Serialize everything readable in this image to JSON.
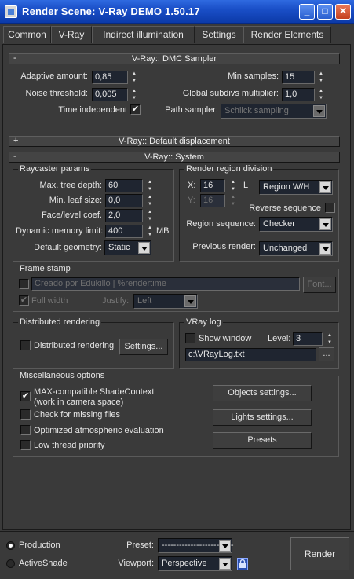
{
  "window": {
    "title": "Render Scene: V-Ray DEMO 1.50.17",
    "controls": [
      "_",
      "□",
      "✕"
    ]
  },
  "tabs": [
    "Common",
    "V-Ray",
    "Indirect illumination",
    "Settings",
    "Render Elements"
  ],
  "dmc": {
    "title": "V-Ray:: DMC Sampler",
    "sign": "-",
    "adaptive_amount_label": "Adaptive amount:",
    "adaptive_amount": "0,85",
    "noise_threshold_label": "Noise threshold:",
    "noise_threshold": "0,005",
    "time_independent_label": "Time independent",
    "time_independent_checked": "✔",
    "min_samples_label": "Min samples:",
    "min_samples": "15",
    "global_subdivs_label": "Global subdivs multiplier:",
    "global_subdivs": "1,0",
    "path_sampler_label": "Path sampler:",
    "path_sampler": "Schlick sampling"
  },
  "displacement": {
    "title": "V-Ray:: Default displacement",
    "sign": "+"
  },
  "system": {
    "title": "V-Ray:: System",
    "sign": "-",
    "raycaster": {
      "title": "Raycaster params",
      "max_tree_depth_label": "Max. tree depth:",
      "max_tree_depth": "60",
      "min_leaf_size_label": "Min. leaf size:",
      "min_leaf_size": "0,0",
      "face_level_label": "Face/level coef.",
      "face_level": "2,0",
      "dyn_memory_label": "Dynamic memory limit:",
      "dyn_memory": "400",
      "dyn_memory_unit": "MB",
      "default_geometry_label": "Default geometry:",
      "default_geometry": "Static"
    },
    "region": {
      "title": "Render region division",
      "x_label": "X:",
      "x_value": "16",
      "l_label": "L",
      "y_label": "Y:",
      "y_value": "16",
      "region_mode": "Region W/H",
      "reverse_label": "Reverse sequence",
      "sequence_label": "Region sequence:",
      "sequence": "Checker",
      "previous_label": "Previous render:",
      "previous": "Unchanged"
    },
    "frame_stamp": {
      "title": "Frame stamp",
      "text": "Creado por Edukillo  | %rendertime",
      "font_button": "Font...",
      "full_width_label": "Full width",
      "justify_label": "Justify:",
      "justify": "Left"
    },
    "distributed": {
      "title": "Distributed rendering",
      "checkbox_label": "Distributed rendering",
      "settings_button": "Settings..."
    },
    "vray_log": {
      "title": "VRay log",
      "show_window_label": "Show window",
      "level_label": "Level:",
      "level": "3",
      "path": "c:\\VRayLog.txt",
      "browse": "..."
    },
    "misc": {
      "title": "Miscellaneous options",
      "max_compat_label": "MAX-compatible ShadeContext",
      "max_compat_sub": "(work in camera space)",
      "max_compat_checked": "✔",
      "missing_files_label": "Check for missing files",
      "optimized_label": "Optimized atmospheric evaluation",
      "low_thread_label": "Low thread priority",
      "objects_button": "Objects settings...",
      "lights_button": "Lights settings...",
      "presets_button": "Presets"
    }
  },
  "footer": {
    "production_label": "Production",
    "activeshade_label": "ActiveShade",
    "preset_label": "Preset:",
    "preset_value": "-------------------------",
    "viewport_label": "Viewport:",
    "viewport_value": "Perspective",
    "render_button": "Render"
  }
}
